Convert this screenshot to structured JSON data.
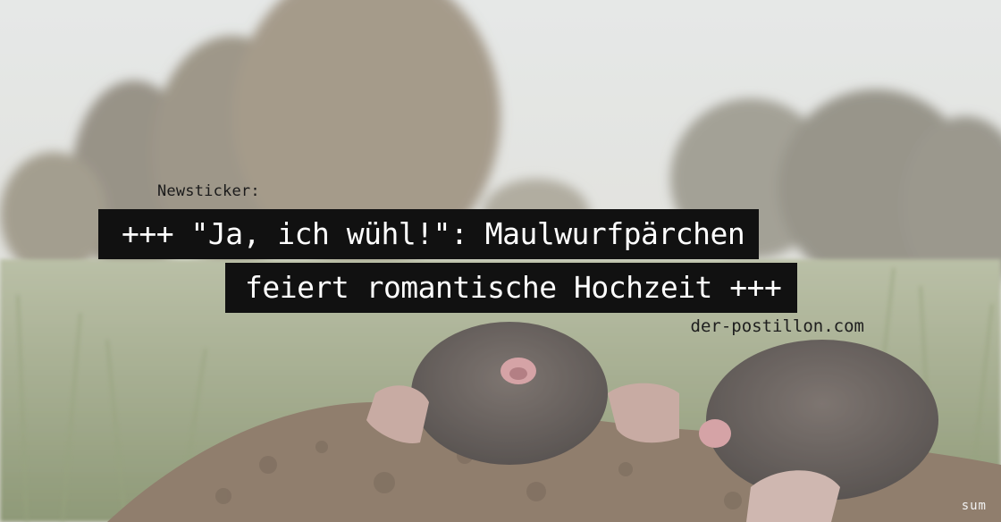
{
  "headline": {
    "kicker": "Newsticker:",
    "line1": "+++ \"Ja, ich wühl!\": Maulwurfpärchen",
    "line2": "feiert romantische Hochzeit +++",
    "source": "der-postillon.com"
  },
  "credit": "sum",
  "colors": {
    "sky": "#d8d8d4",
    "trees": "#6f6a5c",
    "grass": "#8a9468",
    "soil": "#6e5640",
    "mole_fur": "#3c3430",
    "mole_snout": "#c98a8e",
    "banner": "#111111"
  }
}
